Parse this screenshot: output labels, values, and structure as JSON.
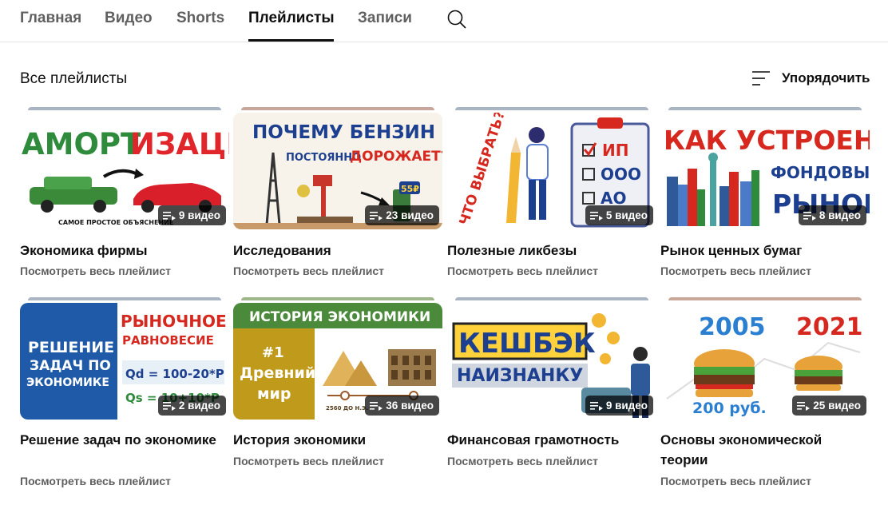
{
  "tabs": [
    {
      "label": "Главная",
      "active": false
    },
    {
      "label": "Видео",
      "active": false
    },
    {
      "label": "Shorts",
      "active": false
    },
    {
      "label": "Плейлисты",
      "active": true
    },
    {
      "label": "Записи",
      "active": false
    }
  ],
  "section_title": "Все плейлисты",
  "sort_label": "Упорядочить",
  "view_full": "Посмотреть весь плейлист",
  "playlists": [
    {
      "title": "Экономика фирмы",
      "count": "9 видео",
      "thumb": {
        "line1a": "АМОРТ",
        "line1b": "ИЗАЦИЯ",
        "caption": "САМОЕ ПРОСТОЕ ОБЪЯСНЕНИЕ"
      }
    },
    {
      "title": "Исследования",
      "count": "23 видео",
      "thumb": {
        "line1": "ПОЧЕМУ БЕНЗИН",
        "line2a": "ПОСТОЯННО",
        "line2b": "ДОРОЖАЕТ?",
        "price": "55₽"
      }
    },
    {
      "title": "Полезные ликбезы",
      "count": "5 видео",
      "thumb": {
        "question": "ЧТО ВЫБРАТЬ?",
        "opt1": "ИП",
        "opt2": "ООО",
        "opt3": "АО"
      }
    },
    {
      "title": "Рынок ценных бумаг",
      "count": "8 видео",
      "thumb": {
        "line1": "КАК УСТРОЕН",
        "line2": "ФОНДОВЫЙ",
        "line3": "РЫНОК"
      }
    },
    {
      "title": "Решение задач по экономике",
      "count": "2 видео",
      "thumb": {
        "left1": "РЕШЕНИЕ",
        "left2": "ЗАДАЧ ПО",
        "left3": "ЭКОНОМИКЕ",
        "right1": "РЫНОЧНОЕ",
        "right2": "РАВНОВЕСИЕ",
        "eq1": "Qd = 100-20*P",
        "eq2": "Qs = 10+10*P"
      }
    },
    {
      "title": "История экономики",
      "count": "36 видео",
      "thumb": {
        "banner": "ИСТОРИЯ ЭКОНОМИКИ",
        "num": "#1",
        "sub1": "Древний",
        "sub2": "мир",
        "date": "2560 ДО Н.Э."
      }
    },
    {
      "title": "Финансовая грамотность",
      "count": "9 видео",
      "thumb": {
        "line1": "КЕШБЭК",
        "line2": "НАИЗНАНКУ"
      }
    },
    {
      "title": "Основы экономической теории",
      "count": "25 видео",
      "thumb": {
        "y1": "2005",
        "y2": "2021",
        "price": "200 руб."
      }
    }
  ],
  "colors": {
    "text_primary": "#0f0f0f",
    "text_secondary": "#606060",
    "badge_bg": "rgba(0,0,0,0.72)"
  }
}
